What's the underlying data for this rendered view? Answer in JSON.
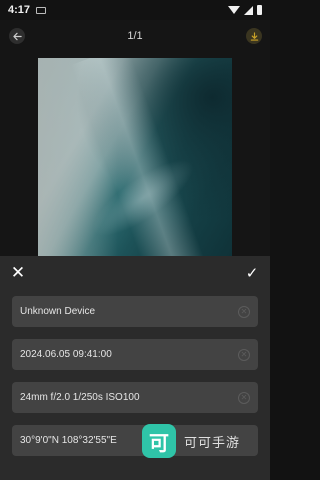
{
  "status_bar": {
    "time": "4:17"
  },
  "top_bar": {
    "counter": "1/1"
  },
  "panel": {
    "close_glyph": "✕",
    "confirm_glyph": "✓",
    "fields": [
      {
        "value": "Unknown Device"
      },
      {
        "value": "2024.06.05 09:41:00"
      },
      {
        "value": "24mm f/2.0 1/250s ISO100"
      },
      {
        "value": "30°9'0\"N 108°32'55\"E"
      }
    ]
  },
  "watermark": {
    "badge": "可",
    "text": "可可手游"
  },
  "icons": {
    "back": "arrow-left-icon",
    "download": "download-icon",
    "close": "close-icon",
    "confirm": "check-icon",
    "clear": "clear-icon"
  },
  "colors": {
    "accent": "#2fc4a8",
    "download_icon": "#c9a227",
    "panel_bg": "#2b2b2b",
    "field_bg": "#434343"
  }
}
